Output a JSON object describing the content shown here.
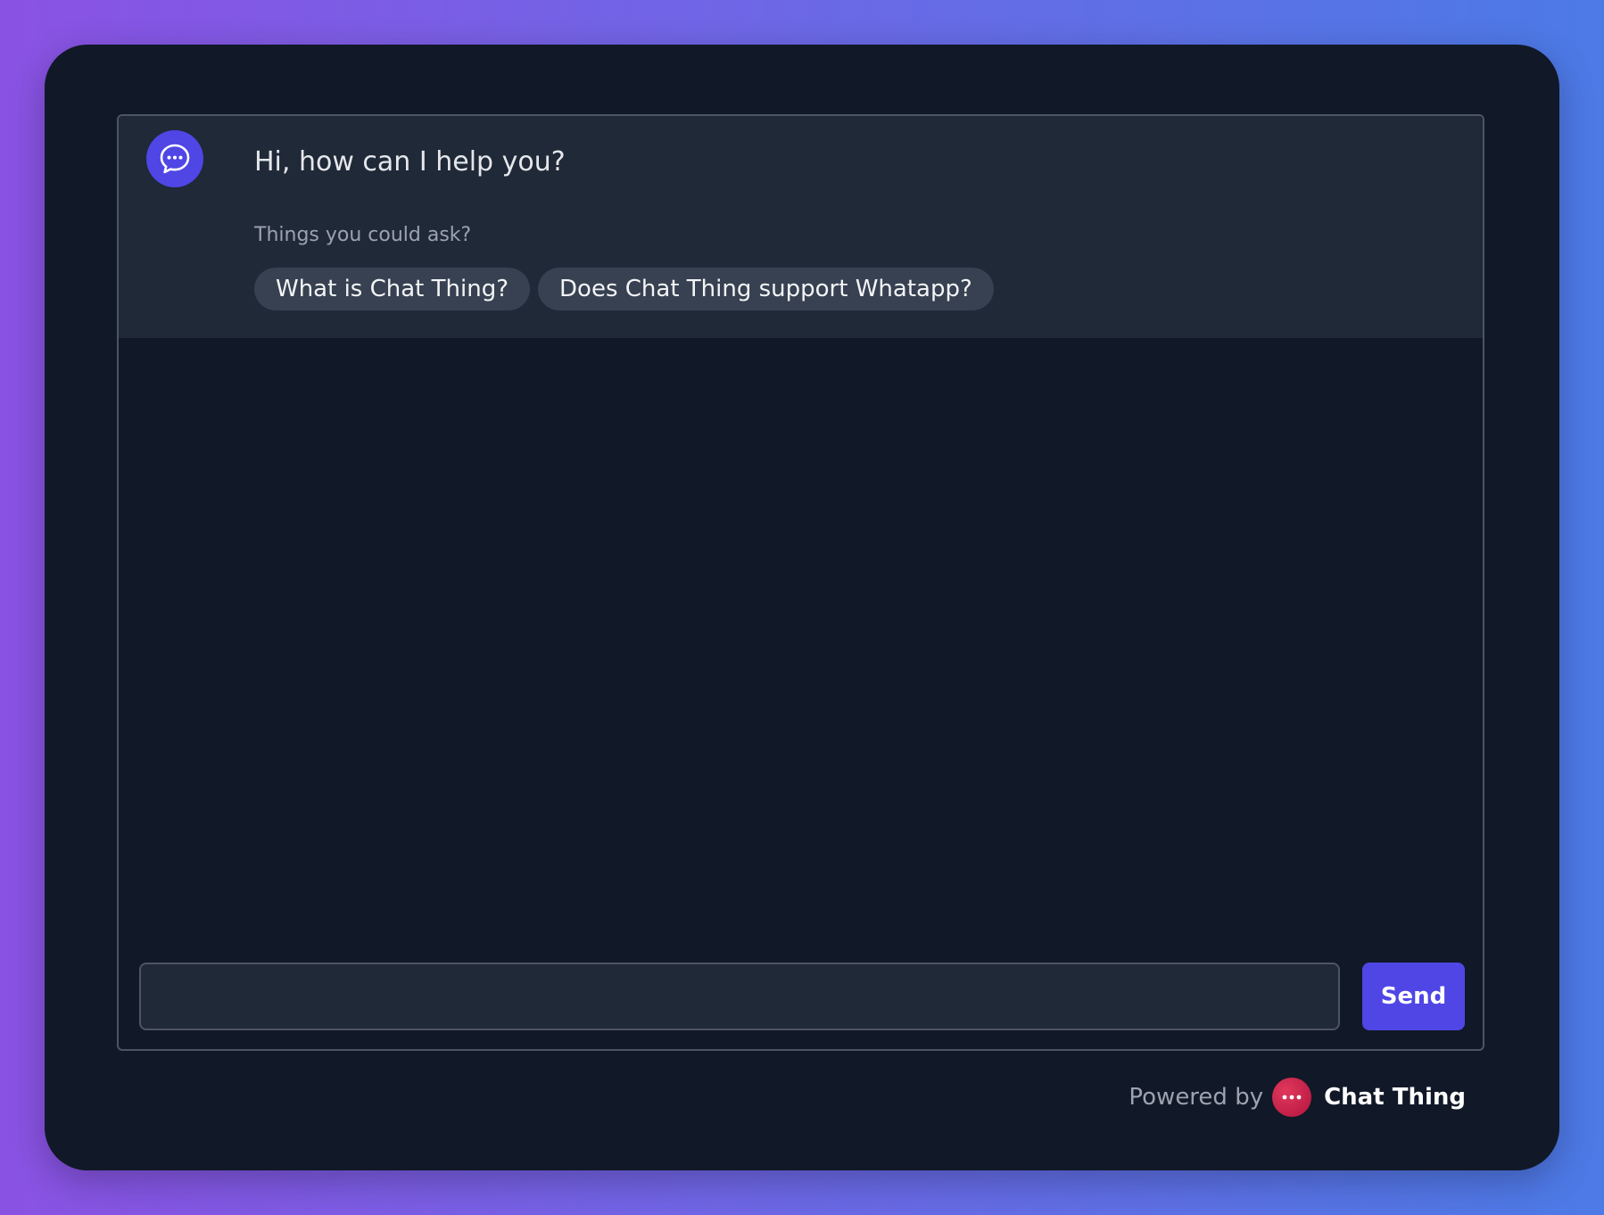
{
  "chat": {
    "greeting": "Hi, how can I help you?",
    "suggestions_label": "Things you could ask?",
    "suggestions": [
      {
        "label": "What is Chat Thing?"
      },
      {
        "label": "Does Chat Thing support Whatapp?"
      }
    ],
    "input": {
      "value": "",
      "placeholder": ""
    },
    "send_label": "Send"
  },
  "footer": {
    "powered_by": "Powered by",
    "brand": "Chat Thing"
  },
  "icons": {
    "bot_avatar": "chat-bubble-icon",
    "brand_logo": "chat-bubble-dots-icon"
  },
  "colors": {
    "accent": "#4f46e5",
    "brand": "#c8204a",
    "panel": "#1f2937",
    "background": "#111827"
  }
}
